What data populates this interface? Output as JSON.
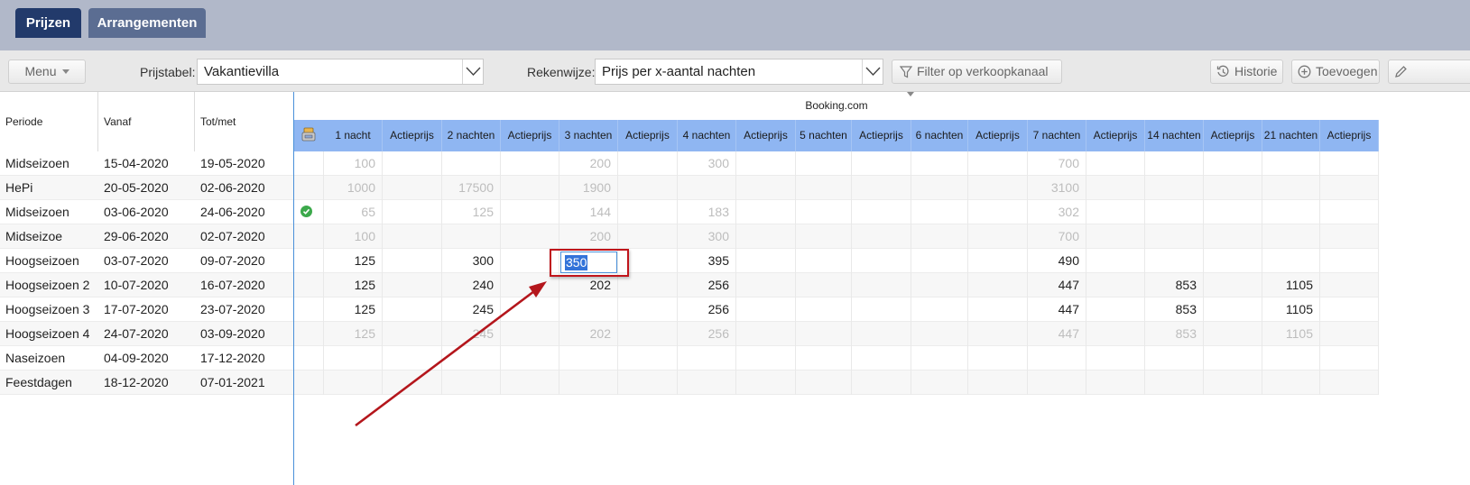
{
  "tabs": [
    {
      "label": "Prijzen",
      "active": true
    },
    {
      "label": "Arrangementen",
      "active": false
    }
  ],
  "toolbar": {
    "menu_label": "Menu",
    "prijstabel_label": "Prijstabel:",
    "prijstabel_value": "Vakantievilla",
    "rekenwijze_label": "Rekenwijze:",
    "rekenwijze_value": "Prijs per x-aantal nachten",
    "filter_label": "Filter op verkoopkanaal",
    "history_label": "Historie",
    "add_label": "Toevoegen"
  },
  "left_headers": [
    "Periode",
    "Vanaf",
    "Tot/met"
  ],
  "channel": "Booking.com",
  "columns": [
    "1 nacht",
    "Actieprijs",
    "2 nachten",
    "Actieprijs",
    "3 nachten",
    "Actieprijs",
    "4 nachten",
    "Actieprijs",
    "5 nachten",
    "Actieprijs",
    "6 nachten",
    "Actieprijs",
    "7 nachten",
    "Actieprijs",
    "14 nachten",
    "Actieprijs",
    "21 nachten",
    "Actieprijs"
  ],
  "rows": [
    {
      "periode": "Midseizoen",
      "vanaf": "15-04-2020",
      "totmet": "19-05-2020",
      "status": "",
      "dim": true,
      "values": [
        "100",
        "",
        "",
        "",
        "200",
        "",
        "300",
        "",
        "",
        "",
        "",
        "",
        "700",
        "",
        "",
        "",
        "",
        ""
      ]
    },
    {
      "periode": "HePi",
      "vanaf": "20-05-2020",
      "totmet": "02-06-2020",
      "status": "",
      "dim": true,
      "values": [
        "1000",
        "",
        "17500",
        "",
        "1900",
        "",
        "",
        "",
        "",
        "",
        "",
        "",
        "3100",
        "",
        "",
        "",
        "",
        ""
      ]
    },
    {
      "periode": "Midseizoen",
      "vanaf": "03-06-2020",
      "totmet": "24-06-2020",
      "status": "ok",
      "dim": true,
      "values": [
        "65",
        "",
        "125",
        "",
        "144",
        "",
        "183",
        "",
        "",
        "",
        "",
        "",
        "302",
        "",
        "",
        "",
        "",
        ""
      ]
    },
    {
      "periode": "Midseizoe",
      "vanaf": "29-06-2020",
      "totmet": "02-07-2020",
      "status": "",
      "dim": true,
      "values": [
        "100",
        "",
        "",
        "",
        "200",
        "",
        "300",
        "",
        "",
        "",
        "",
        "",
        "700",
        "",
        "",
        "",
        "",
        ""
      ]
    },
    {
      "periode": "Hoogseizoen",
      "vanaf": "03-07-2020",
      "totmet": "09-07-2020",
      "status": "",
      "dim": false,
      "values": [
        "125",
        "",
        "300",
        "",
        "",
        "",
        "395",
        "",
        "",
        "",
        "",
        "",
        "490",
        "",
        "",
        "",
        "",
        ""
      ]
    },
    {
      "periode": "Hoogseizoen 2",
      "vanaf": "10-07-2020",
      "totmet": "16-07-2020",
      "status": "",
      "dim": false,
      "values": [
        "125",
        "",
        "240",
        "",
        "202",
        "",
        "256",
        "",
        "",
        "",
        "",
        "",
        "447",
        "",
        "853",
        "",
        "1105",
        ""
      ]
    },
    {
      "periode": "Hoogseizoen 3",
      "vanaf": "17-07-2020",
      "totmet": "23-07-2020",
      "status": "",
      "dim": false,
      "values": [
        "125",
        "",
        "245",
        "",
        "",
        "",
        "256",
        "",
        "",
        "",
        "",
        "",
        "447",
        "",
        "853",
        "",
        "1105",
        ""
      ]
    },
    {
      "periode": "Hoogseizoen 4",
      "vanaf": "24-07-2020",
      "totmet": "03-09-2020",
      "status": "",
      "dim": true,
      "values": [
        "125",
        "",
        "245",
        "",
        "202",
        "",
        "256",
        "",
        "",
        "",
        "",
        "",
        "447",
        "",
        "853",
        "",
        "1105",
        ""
      ]
    },
    {
      "periode": "Naseizoen",
      "vanaf": "04-09-2020",
      "totmet": "17-12-2020",
      "status": "",
      "dim": false,
      "values": [
        "",
        "",
        "",
        "",
        "",
        "",
        "",
        "",
        "",
        "",
        "",
        "",
        "",
        "",
        "",
        "",
        "",
        ""
      ]
    },
    {
      "periode": "Feestdagen",
      "vanaf": "18-12-2020",
      "totmet": "07-01-2021",
      "status": "",
      "dim": false,
      "values": [
        "",
        "",
        "",
        "",
        "",
        "",
        "",
        "",
        "",
        "",
        "",
        "",
        "",
        "",
        "",
        "",
        "",
        ""
      ]
    }
  ],
  "editing": {
    "value": "350"
  },
  "colors": {
    "header_blue": "#8fb6f2",
    "tab_active": "#223a6b",
    "annotation_red": "#c0141b",
    "status_green": "#3ca94b"
  },
  "icons": [
    "chevron-down-icon",
    "filter-icon",
    "history-icon",
    "plus-circle-icon",
    "pencil-icon",
    "check-icon",
    "column-settings-icon"
  ]
}
